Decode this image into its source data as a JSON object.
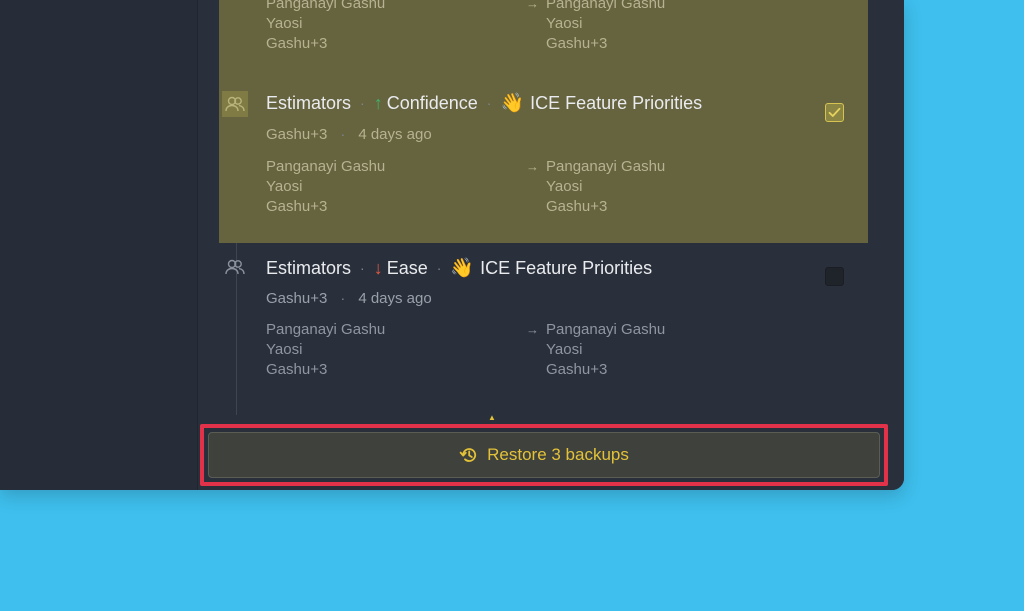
{
  "restore": {
    "label": "Restore 3 backups"
  },
  "entries": [
    {
      "group": "Estimators",
      "metric": "Confidence",
      "direction": "up",
      "project_emoji": "👋",
      "project": "ICE Feature Priorities",
      "author": "Gashu+3",
      "time": "4 days ago",
      "from": [
        "Panganayi Gashu",
        "Yaosi",
        "Gashu+3"
      ],
      "to": [
        "Panganayi Gashu",
        "Yaosi",
        "Gashu+3"
      ],
      "selected": true,
      "checked": true
    },
    {
      "group": "Estimators",
      "metric": "Ease",
      "direction": "down",
      "project_emoji": "👋",
      "project": "ICE Feature Priorities",
      "author": "Gashu+3",
      "time": "4 days ago",
      "from": [
        "Panganayi Gashu",
        "Yaosi",
        "Gashu+3"
      ],
      "to": [
        "Panganayi Gashu",
        "Yaosi",
        "Gashu+3"
      ],
      "selected": false,
      "checked": false
    }
  ],
  "partial_top_entry": {
    "from": [
      "Panganayi Gashu",
      "Yaosi",
      "Gashu+3"
    ],
    "to": [
      "Panganayi Gashu",
      "Yaosi",
      "Gashu+3"
    ]
  },
  "arrows": {
    "up": "↑",
    "down": "↓",
    "to": "→"
  },
  "icons": {
    "user": "users-icon",
    "restore": "history-icon",
    "check": "check-icon"
  },
  "colors": {
    "page_background": "#3ebfed",
    "panel": "#2a303b",
    "selected_row": "#66633f",
    "accent": "#e3c238",
    "highlight_outline": "#e2324a",
    "arrow_up": "#3db46b",
    "arrow_down": "#e85a45"
  }
}
